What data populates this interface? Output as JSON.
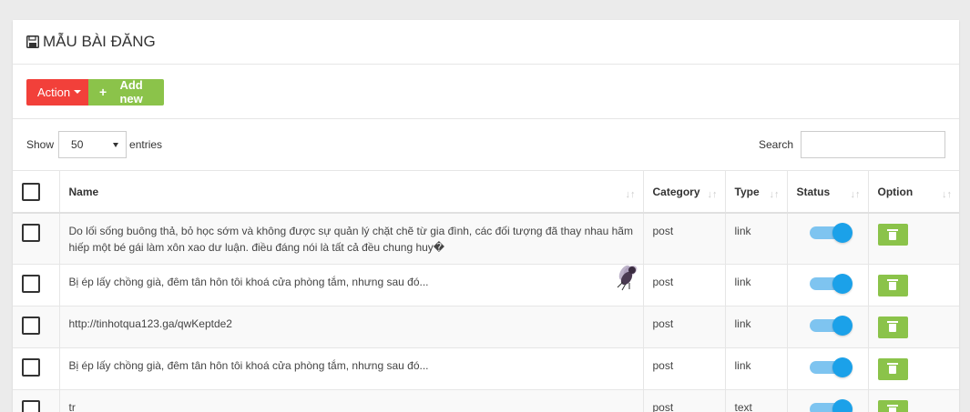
{
  "header": {
    "title": "MẪU BÀI ĐĂNG",
    "icon": "save-icon"
  },
  "toolbar": {
    "action_label": "Action",
    "add_label": "Add new",
    "action_color": "#f2403a",
    "add_color": "#8bc34a"
  },
  "controls": {
    "show_label": "Show",
    "entries_value": "50",
    "entries_label": "entries",
    "search_label": "Search",
    "search_value": ""
  },
  "table": {
    "columns": [
      "Name",
      "Category",
      "Type",
      "Status",
      "Option"
    ],
    "rows": [
      {
        "name": "Do lối sống buông thả, bỏ học sớm và không được sự quản lý chặt chẽ từ gia đình, các đối tượng đã thay nhau hãm hiếp một bé gái làm xôn xao dư luận. điều đáng nói là tất cả đều chung huy�",
        "category": "post",
        "type": "link",
        "status": "on"
      },
      {
        "name": "Bị ép lấy chồng già, đêm tân hôn tôi khoá cửa phòng tắm, nhưng sau đó...",
        "category": "post",
        "type": "link",
        "status": "on"
      },
      {
        "name": "http://tinhotqua123.ga/qwKeptde2",
        "category": "post",
        "type": "link",
        "status": "on"
      },
      {
        "name": "Bị ép lấy chồng già, đêm tân hôn tôi khoá cửa phòng tắm, nhưng sau đó...",
        "category": "post",
        "type": "link",
        "status": "on"
      },
      {
        "name": "tr",
        "category": "post",
        "type": "text",
        "status": "on"
      }
    ]
  }
}
